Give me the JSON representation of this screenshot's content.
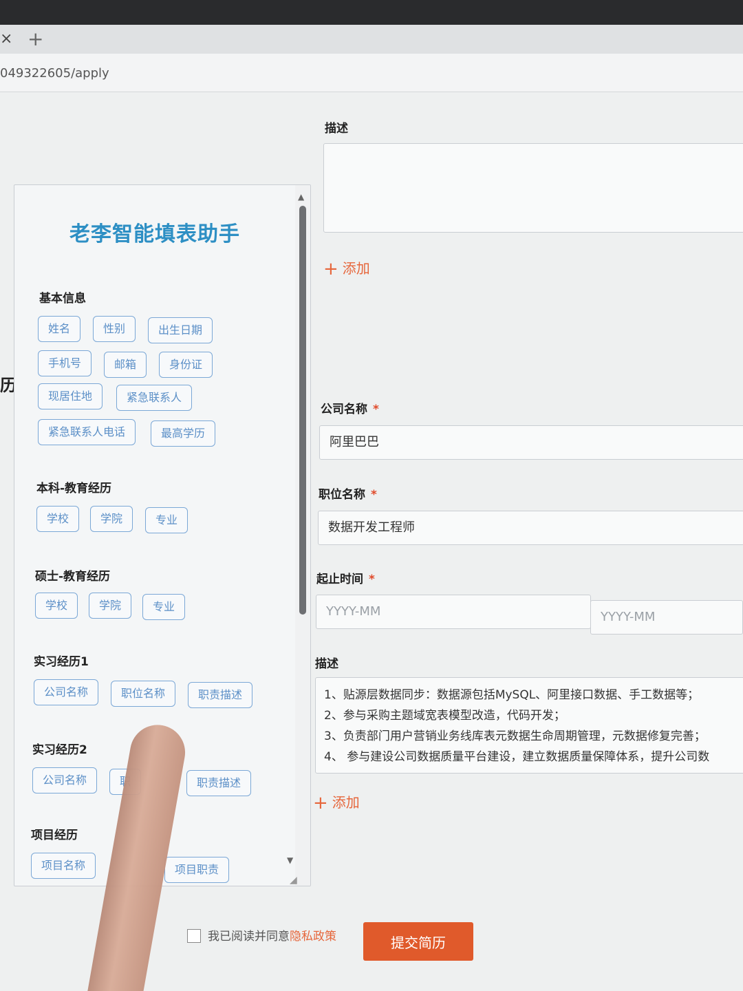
{
  "browser": {
    "tab_close": "×",
    "tab_new": "+",
    "url": "049322605/apply"
  },
  "page": {
    "side_title": "历"
  },
  "helper": {
    "title": "老李智能填表助手",
    "sections": {
      "basic": {
        "title": "基本信息",
        "chips": [
          "姓名",
          "性别",
          "出生日期",
          "手机号",
          "邮箱",
          "身份证",
          "现居住地",
          "紧急联系人",
          "紧急联系人电话",
          "最高学历"
        ]
      },
      "bachelor": {
        "title": "本科-教育经历",
        "chips": [
          "学校",
          "学院",
          "专业"
        ]
      },
      "master": {
        "title": "硕士-教育经历",
        "chips": [
          "学校",
          "学院",
          "专业"
        ]
      },
      "intern1": {
        "title": "实习经历1",
        "chips": [
          "公司名称",
          "职位名称",
          "职责描述"
        ]
      },
      "intern2": {
        "title": "实习经历2",
        "chips": [
          "公司名称",
          "职",
          "职责描述"
        ]
      },
      "project": {
        "title": "项目经历",
        "chips": [
          "项目名称",
          "项目职责"
        ]
      }
    }
  },
  "form": {
    "top_desc_label": "描述",
    "add_label": "添加",
    "company_label": "公司名称",
    "company_value": "阿里巴巴",
    "position_label": "职位名称",
    "position_value": "数据开发工程师",
    "period_label": "起止时间",
    "start_placeholder": "YYYY-MM",
    "end_placeholder": "YYYY-MM",
    "desc_label": "描述",
    "desc_lines": [
      "1、贴源层数据同步：数据源包括MySQL、阿里接口数据、手工数据等；",
      "2、参与采购主题域宽表模型改造，代码开发；",
      "3、负责部门用户营销业务线库表元数据生命周期管理，元数据修复完善；",
      "4、 参与建设公司数据质量平台建设，建立数据质量保障体系，提升公司数"
    ],
    "add_label_2": "添加",
    "required_mark": "*"
  },
  "footer": {
    "agree_text": "我已阅读并同意",
    "privacy_link": "隐私政策",
    "submit_label": "提交简历"
  },
  "colors": {
    "accent": "#e05a2b",
    "chip_border": "#7aa7d6",
    "title": "#2d8fc4"
  }
}
